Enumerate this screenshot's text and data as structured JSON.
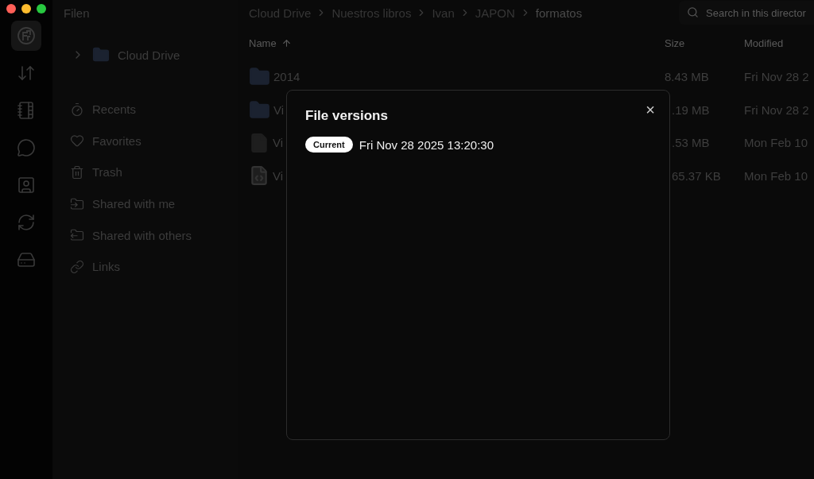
{
  "window": {
    "title": "Filen"
  },
  "rail": [
    {
      "selected": true
    },
    {
      "selected": false
    },
    {
      "selected": false
    },
    {
      "selected": false
    },
    {
      "selected": false
    },
    {
      "selected": false
    },
    {
      "selected": false
    }
  ],
  "sidebar": {
    "tree": {
      "label": "Cloud Drive",
      "expanded": false
    },
    "items": [
      {
        "label": "Recents"
      },
      {
        "label": "Favorites"
      },
      {
        "label": "Trash"
      },
      {
        "label": "Shared with me"
      },
      {
        "label": "Shared with others"
      },
      {
        "label": "Links"
      }
    ]
  },
  "breadcrumbs": [
    "Cloud Drive",
    "Nuestros libros",
    "Ivan",
    "JAPON",
    "formatos"
  ],
  "search": {
    "placeholder": "Search in this director"
  },
  "table": {
    "columns": [
      "Name",
      "Size",
      "Modified"
    ],
    "rows": [
      {
        "kind": "folder",
        "name": "2014",
        "size": "8.43 MB",
        "modified": "Fri Nov 28 2",
        "covered": false
      },
      {
        "kind": "folder",
        "name": "Vi",
        "size": ".19 MB",
        "modified": "Fri Nov 28 2",
        "covered": true
      },
      {
        "kind": "file",
        "name": "Vi",
        "size": ".53 MB",
        "modified": "Mon Feb 10",
        "covered": true
      },
      {
        "kind": "code",
        "name": "Vi",
        "size": "65.37 KB",
        "modified": "Mon Feb 10",
        "covered": true
      }
    ]
  },
  "dialog": {
    "title": "File versions",
    "close": "×",
    "versions": [
      {
        "badge": "Current",
        "date": "Fri Nov 28 2025 13:20:30"
      }
    ]
  }
}
